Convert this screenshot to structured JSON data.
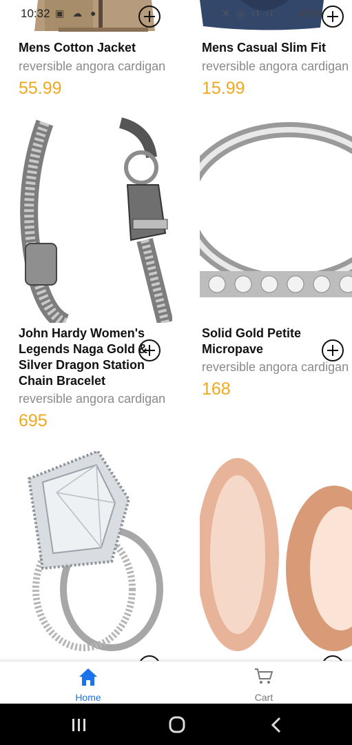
{
  "status_bar": {
    "time": "10:32",
    "battery": "49%"
  },
  "products": [
    {
      "title": "Mens Cotton Jacket",
      "subtitle": "reversible angora cardigan",
      "price": "55.99"
    },
    {
      "title": "Mens Casual Slim Fit",
      "subtitle": "reversible angora cardigan",
      "price": "15.99"
    },
    {
      "title": "John Hardy Women's Legends Naga Gold & Silver Dragon Station Chain Bracelet",
      "subtitle": "reversible angora cardigan",
      "price": "695"
    },
    {
      "title": "Solid Gold Petite Micropave",
      "subtitle": "reversible angora cardigan",
      "price": "168"
    }
  ],
  "bottom_nav": {
    "items": [
      {
        "label": "Home",
        "icon": "home-icon",
        "active": true
      },
      {
        "label": "Cart",
        "icon": "cart-icon",
        "active": false
      }
    ]
  },
  "colors": {
    "price": "#f2a81d",
    "active_nav": "#1a73e8"
  }
}
